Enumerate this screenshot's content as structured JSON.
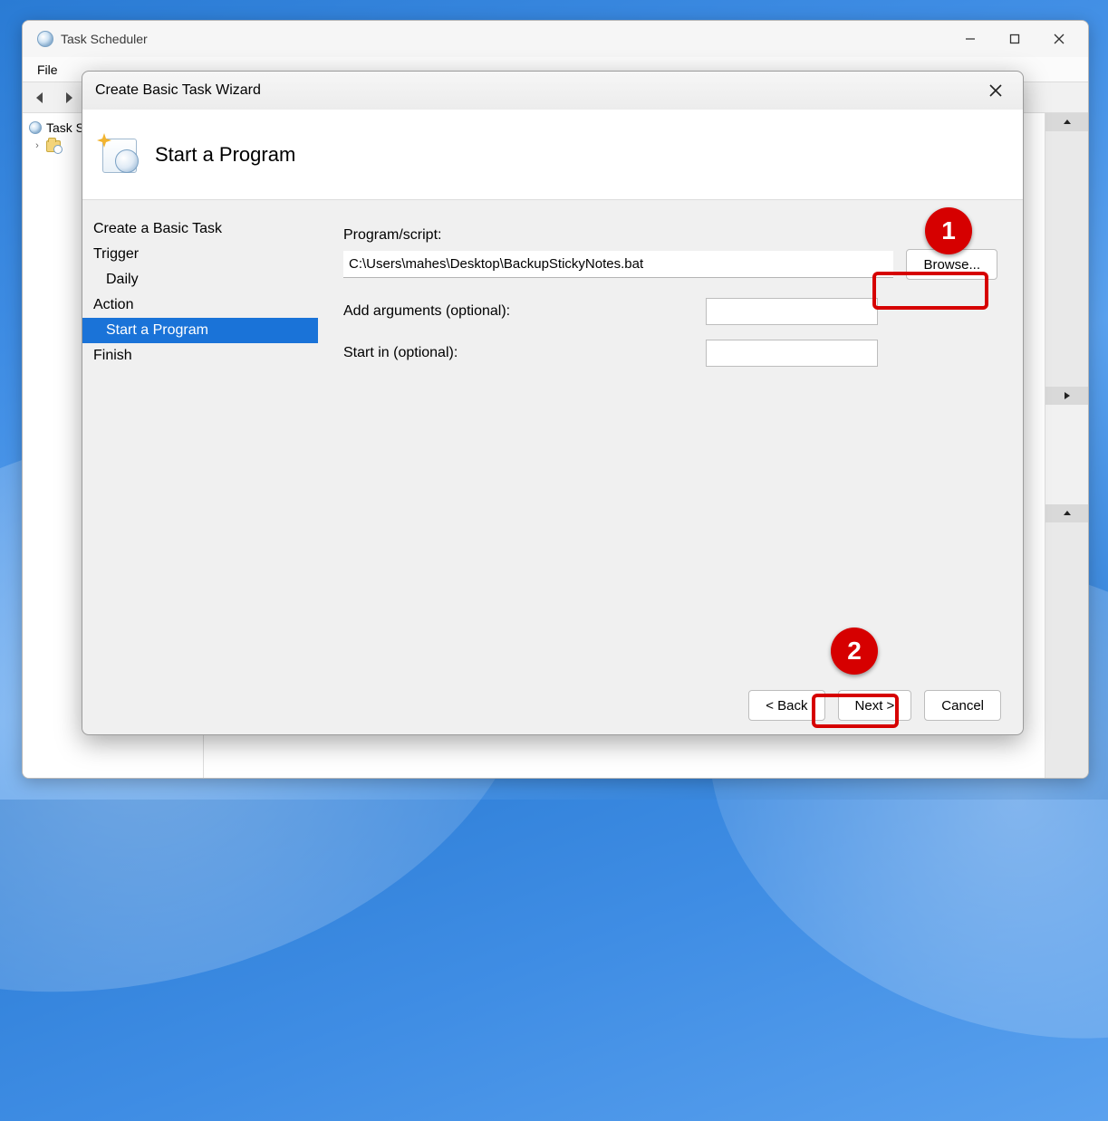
{
  "mainWindow": {
    "title": "Task Scheduler",
    "menus": [
      "File"
    ],
    "tree": {
      "root": "Task Scheduler"
    }
  },
  "wizard": {
    "title": "Create Basic Task Wizard",
    "headerTitle": "Start a Program",
    "steps": {
      "createBasic": "Create a Basic Task",
      "trigger": "Trigger",
      "triggerSub": "Daily",
      "action": "Action",
      "actionSub": "Start a Program",
      "finish": "Finish"
    },
    "form": {
      "programLabel": "Program/script:",
      "programValue": "C:\\Users\\mahes\\Desktop\\BackupStickyNotes.bat",
      "browse": "Browse...",
      "argsLabel": "Add arguments (optional):",
      "argsValue": "",
      "startInLabel": "Start in (optional):",
      "startInValue": ""
    },
    "footer": {
      "back": "< Back",
      "next": "Next >",
      "cancel": "Cancel"
    }
  },
  "annotations": {
    "one": "1",
    "two": "2"
  }
}
